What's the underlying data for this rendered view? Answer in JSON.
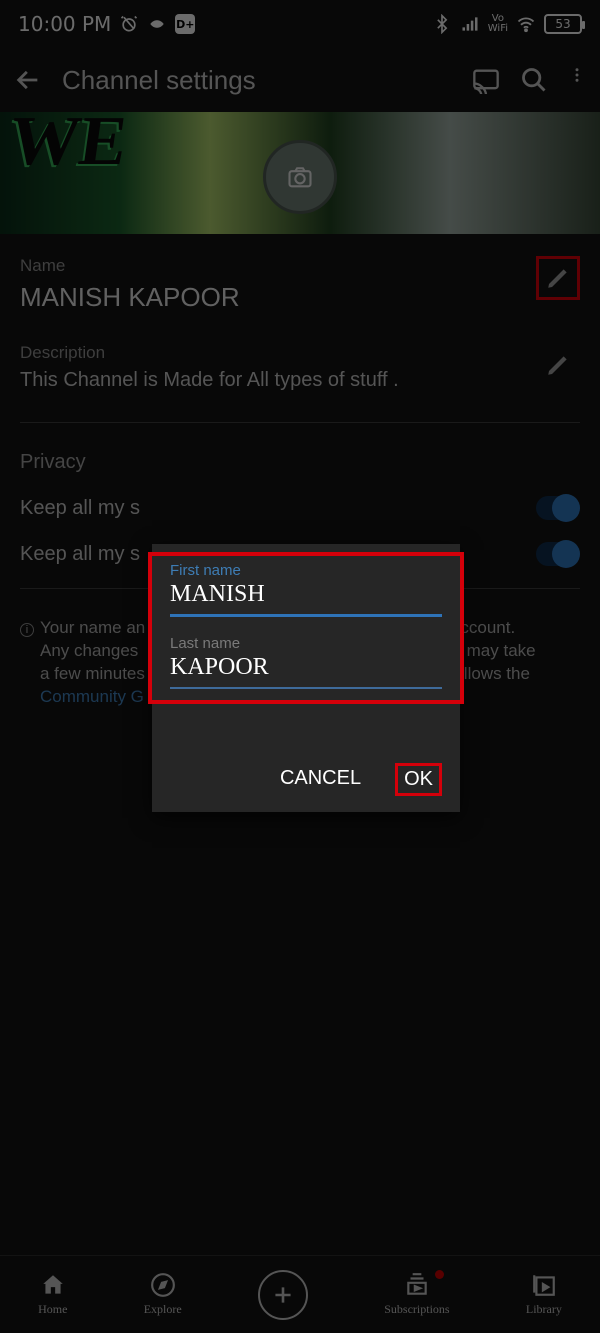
{
  "status": {
    "time": "10:00 PM",
    "battery": "53"
  },
  "header": {
    "title": "Channel settings"
  },
  "name": {
    "label": "Name",
    "value": "MANISH KAPOOR"
  },
  "description": {
    "label": "Description",
    "value": "This Channel is Made for All types of stuff ."
  },
  "privacy": {
    "label": "Privacy",
    "row1": "Keep all my s",
    "row2": "Keep all my s"
  },
  "info": {
    "line1a": "Your name an",
    "line1b": " Account.",
    "line2a": "Any changes ",
    "line2b": "nd may take",
    "line3a": "a few minutes",
    "line3b": " follows the",
    "link": "Community G"
  },
  "dialog": {
    "first_label": "First name",
    "first_value": "MANISH",
    "last_label": "Last name",
    "last_value": "KAPOOR",
    "cancel": "CANCEL",
    "ok": "OK"
  },
  "nav": {
    "home": "Home",
    "explore": "Explore",
    "subscriptions": "Subscriptions",
    "library": "Library"
  }
}
